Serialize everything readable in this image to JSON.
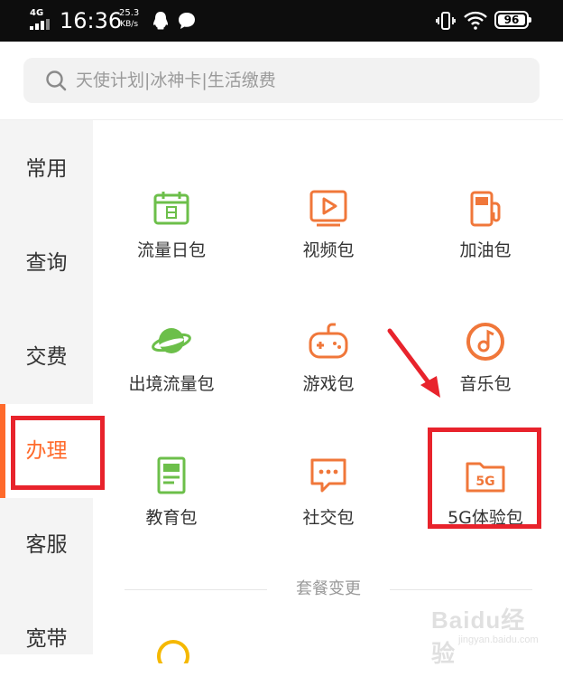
{
  "status_bar": {
    "network": "4G",
    "time": "16:36",
    "speed_value": "25.3",
    "speed_unit": "KB/s",
    "battery": "96"
  },
  "search": {
    "placeholder": "天使计划|冰神卡|生活缴费",
    "icon": "search-icon"
  },
  "sidebar": {
    "items": [
      {
        "label": "常用",
        "active": false
      },
      {
        "label": "查询",
        "active": false
      },
      {
        "label": "交费",
        "active": false
      },
      {
        "label": "办理",
        "active": true
      },
      {
        "label": "客服",
        "active": false
      },
      {
        "label": "宽带",
        "active": false
      }
    ]
  },
  "grid": {
    "items": [
      {
        "label": "流量日包",
        "icon": "calendar-icon",
        "color": "#6cbf4a"
      },
      {
        "label": "视频包",
        "icon": "video-play-icon",
        "color": "#f0773a"
      },
      {
        "label": "加油包",
        "icon": "fuel-pump-icon",
        "color": "#f0773a"
      },
      {
        "label": "出境流量包",
        "icon": "planet-icon",
        "color": "#6cbf4a"
      },
      {
        "label": "游戏包",
        "icon": "gamepad-icon",
        "color": "#f0773a"
      },
      {
        "label": "音乐包",
        "icon": "music-disc-icon",
        "color": "#f0773a"
      },
      {
        "label": "教育包",
        "icon": "book-icon",
        "color": "#6cbf4a"
      },
      {
        "label": "社交包",
        "icon": "chat-bubble-icon",
        "color": "#f0773a"
      },
      {
        "label": "5G体验包",
        "icon": "5g-folder-icon",
        "color": "#f0773a",
        "icon_text": "5G"
      }
    ]
  },
  "section_divider": {
    "label": "套餐变更"
  },
  "watermark": {
    "text": "Baidu经验",
    "url": "jingyan.baidu.com"
  },
  "colors": {
    "accent": "#ff6a2b",
    "highlight": "#e8232c",
    "green": "#6cbf4a",
    "orange": "#f0773a"
  }
}
